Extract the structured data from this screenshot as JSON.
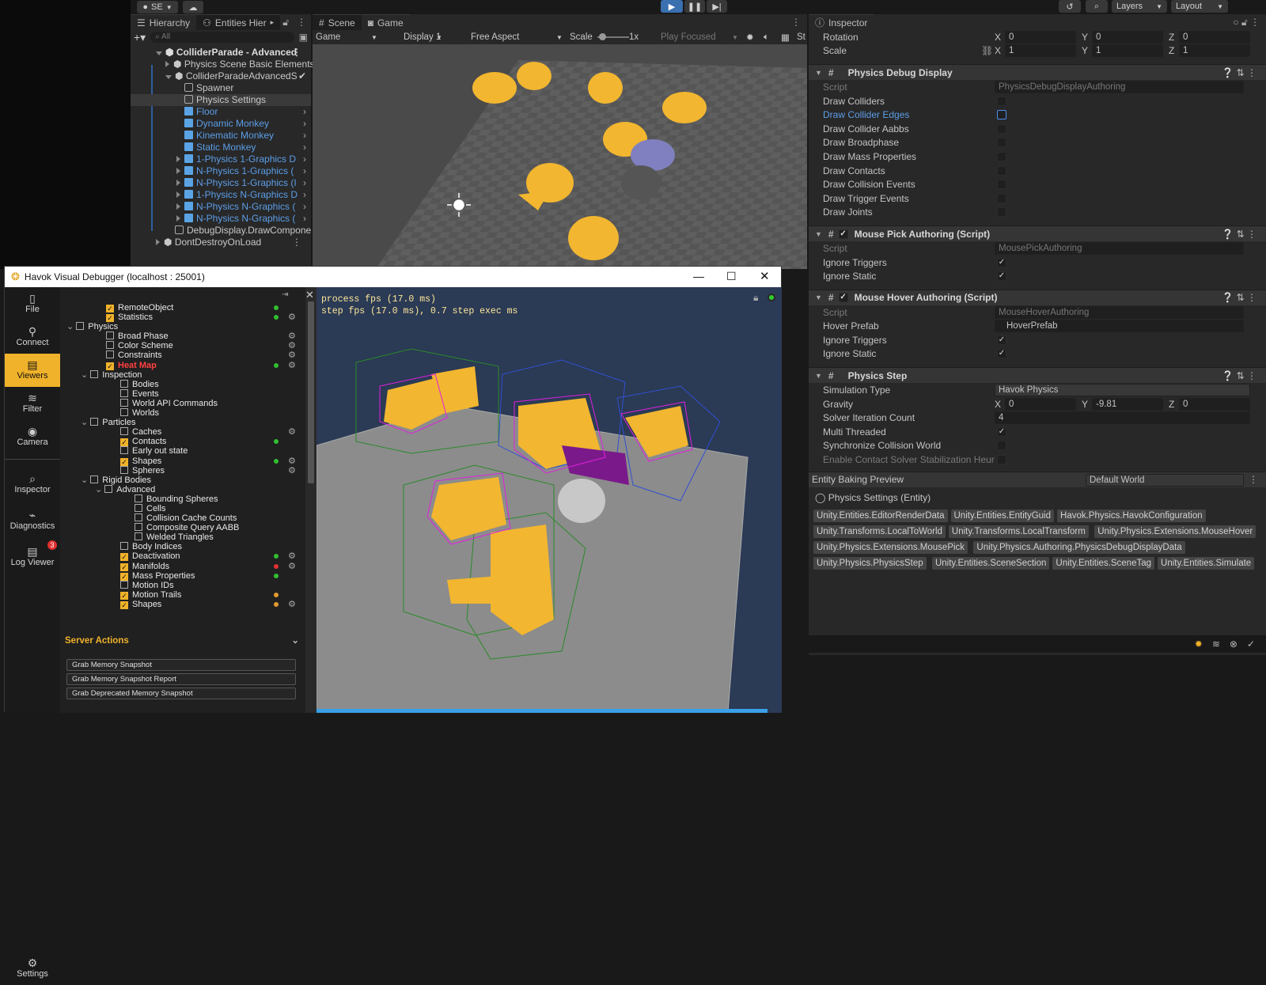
{
  "unity": {
    "toolbar": {
      "account_label": "SE",
      "layers_label": "Layers",
      "layout_label": "Layout"
    },
    "hierarchy": {
      "tab_hierarchy": "Hierarchy",
      "tab_entities": "Entities Hier",
      "search_placeholder": "All",
      "items": [
        {
          "label": "ColliderParade - Advanced",
          "kind": "scene"
        },
        {
          "label": "Physics Scene Basic Elements",
          "kind": "sub"
        },
        {
          "label": "ColliderParadeAdvancedS",
          "kind": "sub"
        },
        {
          "label": "Spawner",
          "kind": "go"
        },
        {
          "label": "Physics Settings",
          "kind": "go"
        },
        {
          "label": "Floor",
          "kind": "prefab"
        },
        {
          "label": "Dynamic Monkey",
          "kind": "prefab"
        },
        {
          "label": "Kinematic Monkey",
          "kind": "prefab"
        },
        {
          "label": "Static Monkey",
          "kind": "prefab"
        },
        {
          "label": "1-Physics 1-Graphics D",
          "kind": "prefab"
        },
        {
          "label": "N-Physics 1-Graphics (",
          "kind": "prefab"
        },
        {
          "label": "N-Physics 1-Graphics (I",
          "kind": "prefab"
        },
        {
          "label": "1-Physics N-Graphics D",
          "kind": "prefab"
        },
        {
          "label": "N-Physics N-Graphics (",
          "kind": "prefab"
        },
        {
          "label": "N-Physics N-Graphics (",
          "kind": "prefab"
        },
        {
          "label": "DebugDisplay.DrawCompone",
          "kind": "go"
        },
        {
          "label": "DontDestroyOnLoad",
          "kind": "scene"
        }
      ]
    },
    "game": {
      "tab_scene": "Scene",
      "tab_game": "Game",
      "mode": "Game",
      "display": "Display 1",
      "aspect": "Free Aspect",
      "scale_label": "Scale",
      "scale_value": "1x",
      "play_focused": "Play Focused"
    },
    "inspector": {
      "tab": "Inspector",
      "rotation_label": "Rotation",
      "scale_label": "Scale",
      "rotation": {
        "x": "0",
        "y": "0",
        "z": "0"
      },
      "scale": {
        "x": "1",
        "y": "1",
        "z": "1"
      },
      "physics_debug": {
        "title": "Physics Debug Display",
        "script_label": "Script",
        "script_value": "PhysicsDebugDisplayAuthoring",
        "rows": [
          "Draw Colliders",
          "Draw Collider Edges",
          "Draw Collider Aabbs",
          "Draw Broadphase",
          "Draw Mass Properties",
          "Draw Contacts",
          "Draw Collision Events",
          "Draw Trigger Events",
          "Draw Joints"
        ]
      },
      "mouse_pick": {
        "title": "Mouse Pick Authoring (Script)",
        "script_label": "Script",
        "script_value": "MousePickAuthoring",
        "rows": [
          "Ignore Triggers",
          "Ignore Static"
        ]
      },
      "mouse_hover": {
        "title": "Mouse Hover Authoring (Script)",
        "script_label": "Script",
        "script_value": "MouseHoverAuthoring",
        "hover_prefab_label": "Hover Prefab",
        "hover_prefab_value": "HoverPrefab",
        "rows": [
          "Ignore Triggers",
          "Ignore Static"
        ]
      },
      "physics_step": {
        "title": "Physics Step",
        "simulation_type_label": "Simulation Type",
        "simulation_type_value": "Havok Physics",
        "gravity_label": "Gravity",
        "gravity": {
          "x": "0",
          "y": "-9.81",
          "z": "0"
        },
        "solver_label": "Solver Iteration Count",
        "solver_value": "4",
        "multi_label": "Multi Threaded",
        "sync_label": "Synchronize Collision World",
        "enable_label": "Enable Contact Solver Stabilization Heur"
      },
      "baking": {
        "title": "Entity Baking Preview",
        "world": "Default World",
        "entity": "Physics Settings (Entity)",
        "components": [
          "Unity.Entities.EditorRenderData",
          "Unity.Entities.EntityGuid",
          "Havok.Physics.HavokConfiguration",
          "Unity.Transforms.LocalToWorld",
          "Unity.Transforms.LocalTransform",
          "Unity.Physics.Extensions.MouseHover",
          "Unity.Physics.Extensions.MousePick",
          "Unity.Physics.Authoring.PhysicsDebugDisplayData",
          "Unity.Physics.PhysicsStep",
          "Unity.Entities.SceneSection",
          "Unity.Entities.SceneTag",
          "Unity.Entities.Simulate"
        ]
      }
    }
  },
  "havok": {
    "title": "Havok Visual Debugger  (localhost : 25001)",
    "sidebar": [
      "File",
      "Connect",
      "Viewers",
      "Filter",
      "Camera",
      "Inspector",
      "Diagnostics",
      "Log Viewer",
      "Settings"
    ],
    "log_badge": "3",
    "viewers": [
      {
        "label": "RemoteObject",
        "level": 2,
        "checked": true,
        "dot": "green",
        "gear": false
      },
      {
        "label": "Statistics",
        "level": 2,
        "checked": true,
        "dot": "green",
        "gear": true
      },
      {
        "label": "Physics",
        "level": 0,
        "checked": false,
        "expand": true
      },
      {
        "label": "Broad Phase",
        "level": 2,
        "checked": false,
        "gear": true
      },
      {
        "label": "Color Scheme",
        "level": 2,
        "checked": false,
        "gear": true
      },
      {
        "label": "Constraints",
        "level": 2,
        "checked": false,
        "gear": true
      },
      {
        "label": "Heat Map",
        "level": 2,
        "checked": true,
        "dot": "green",
        "gear": true,
        "highlight": true
      },
      {
        "label": "Inspection",
        "level": 1,
        "checked": false,
        "expand": true
      },
      {
        "label": "Bodies",
        "level": 3,
        "checked": false
      },
      {
        "label": "Events",
        "level": 3,
        "checked": false
      },
      {
        "label": "World API Commands",
        "level": 3,
        "checked": false
      },
      {
        "label": "Worlds",
        "level": 3,
        "checked": false
      },
      {
        "label": "Particles",
        "level": 1,
        "checked": false,
        "expand": true
      },
      {
        "label": "Caches",
        "level": 3,
        "checked": false,
        "gear": true
      },
      {
        "label": "Contacts",
        "level": 3,
        "checked": true,
        "dot": "green"
      },
      {
        "label": "Early out state",
        "level": 3,
        "checked": false
      },
      {
        "label": "Shapes",
        "level": 3,
        "checked": true,
        "dot": "green",
        "gear": true
      },
      {
        "label": "Spheres",
        "level": 3,
        "checked": false,
        "gear": true
      },
      {
        "label": "Rigid Bodies",
        "level": 1,
        "checked": false,
        "expand": true
      },
      {
        "label": "Advanced",
        "level": 2,
        "checked": false,
        "expand": true
      },
      {
        "label": "Bounding Spheres",
        "level": 4,
        "checked": false
      },
      {
        "label": "Cells",
        "level": 4,
        "checked": false
      },
      {
        "label": "Collision Cache Counts",
        "level": 4,
        "checked": false
      },
      {
        "label": "Composite Query AABB",
        "level": 4,
        "checked": false
      },
      {
        "label": "Welded Triangles",
        "level": 4,
        "checked": false
      },
      {
        "label": "Body Indices",
        "level": 3,
        "checked": false
      },
      {
        "label": "Deactivation",
        "level": 3,
        "checked": true,
        "dot": "green",
        "gear": true
      },
      {
        "label": "Manifolds",
        "level": 3,
        "checked": true,
        "dot": "red",
        "gear": true
      },
      {
        "label": "Mass Properties",
        "level": 3,
        "checked": true,
        "dot": "green"
      },
      {
        "label": "Motion IDs",
        "level": 3,
        "checked": false
      },
      {
        "label": "Motion Trails",
        "level": 3,
        "checked": true,
        "dot": "orange"
      },
      {
        "label": "Shapes",
        "level": 3,
        "checked": true,
        "dot": "orange",
        "gear": true
      }
    ],
    "server_actions": {
      "title": "Server Actions",
      "buttons": [
        "Grab Memory Snapshot",
        "Grab Memory Snapshot Report",
        "Grab Deprecated Memory Snapshot"
      ]
    },
    "viewport": {
      "line1": "process fps (17.0 ms)",
      "line2": "step fps (17.0 ms), 0.7 step exec ms"
    }
  },
  "colors": {
    "accent": "#f0b22a",
    "unity_blue": "#5c9ee8",
    "monkey": "#f2b630"
  }
}
